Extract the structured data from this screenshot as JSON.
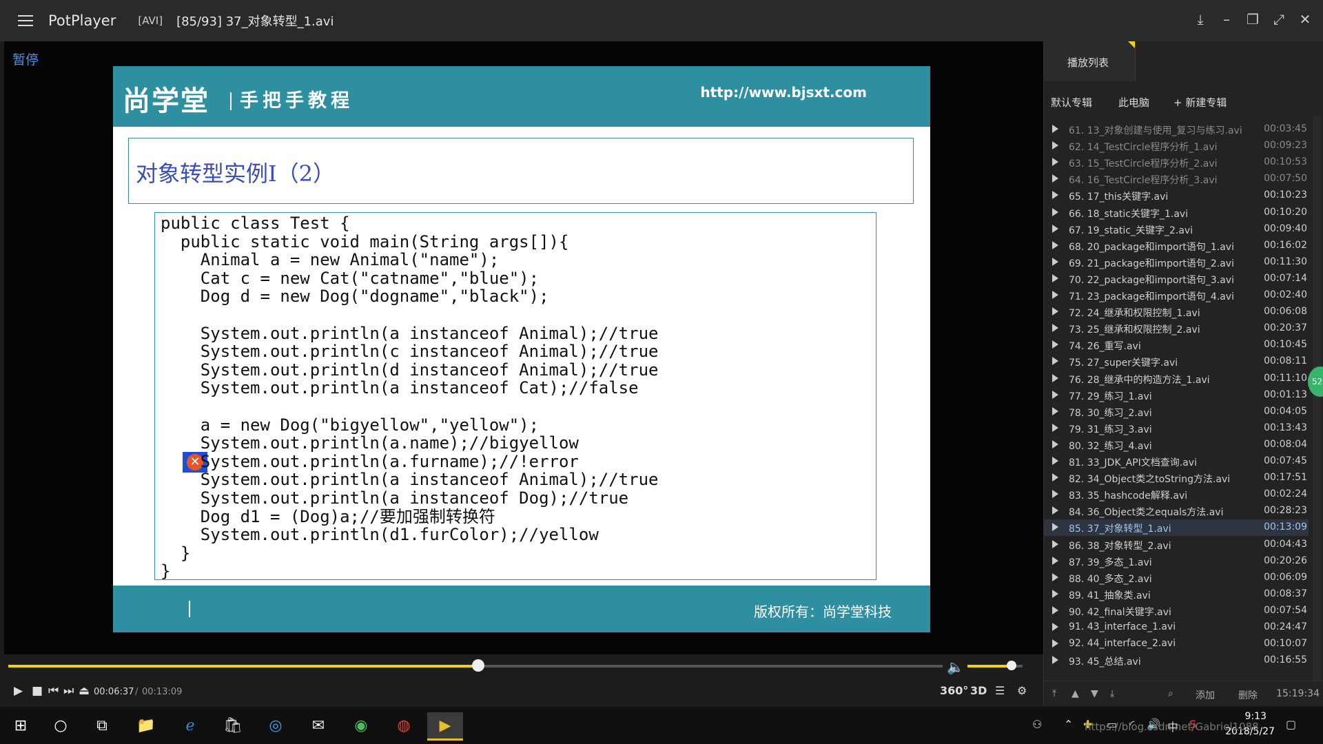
{
  "titlebar": {
    "app_name": "PotPlayer",
    "format": "[AVI]",
    "file_title": "[85/93] 37_对象转型_1.avi"
  },
  "video": {
    "status": "暂停",
    "slide": {
      "logo": "尚学堂",
      "subtitle": "手把手教程",
      "url": "http://www.bjsxt.com",
      "title": "对象转型实例Ⅰ（2）",
      "code": [
        "public class Test {",
        "  public static void main(String args[]){",
        "    Animal a = new Animal(\"name\");",
        "    Cat c = new Cat(\"catname\",\"blue\");",
        "    Dog d = new Dog(\"dogname\",\"black\");",
        "",
        "    System.out.println(a instanceof Animal);//true",
        "    System.out.println(c instanceof Animal);//true",
        "    System.out.println(d instanceof Animal);//true",
        "    System.out.println(a instanceof Cat);//false",
        "",
        "    a = new Dog(\"bigyellow\",\"yellow\");",
        "    System.out.println(a.name);//bigyellow",
        "    System.out.println(a.furname);//!error",
        "    System.out.println(a instanceof Animal);//true",
        "    System.out.println(a instanceof Dog);//true",
        "    Dog d1 = (Dog)a;//要加强制转换符",
        "    System.out.println(d1.furColor);//yellow",
        "  }",
        "}"
      ],
      "footer": "版权所有：尚学堂科技"
    }
  },
  "playback": {
    "current": "00:06:37",
    "separator": "/",
    "total": "00:13:09",
    "progress": 0.503,
    "volume": 0.8
  },
  "controls": {
    "btn_360": "360°",
    "btn_3d": "3D"
  },
  "playlist": {
    "tab": "播放列表",
    "subtabs": [
      "默认专辑",
      "此电脑",
      "+ 新建专辑"
    ],
    "items": [
      {
        "name": "61. 13_对象创建与使用_复习与练习.avi",
        "dur": "00:03:45"
      },
      {
        "name": "62. 14_TestCircle程序分析_1.avi",
        "dur": "00:09:23"
      },
      {
        "name": "63. 15_TestCircle程序分析_2.avi",
        "dur": "00:10:53"
      },
      {
        "name": "64. 16_TestCircle程序分析_3.avi",
        "dur": "00:07:50"
      },
      {
        "name": "65. 17_this关键字.avi",
        "dur": "00:10:23"
      },
      {
        "name": "66. 18_static关键字_1.avi",
        "dur": "00:10:20"
      },
      {
        "name": "67. 19_static_关键字_2.avi",
        "dur": "00:09:40"
      },
      {
        "name": "68. 20_package和import语句_1.avi",
        "dur": "00:16:02"
      },
      {
        "name": "69. 21_package和import语句_2.avi",
        "dur": "00:11:30"
      },
      {
        "name": "70. 22_package和import语句_3.avi",
        "dur": "00:07:14"
      },
      {
        "name": "71. 23_package和import语句_4.avi",
        "dur": "00:02:40"
      },
      {
        "name": "72. 24_继承和权限控制_1.avi",
        "dur": "00:06:08"
      },
      {
        "name": "73. 25_继承和权限控制_2.avi",
        "dur": "00:20:37"
      },
      {
        "name": "74. 26_重写.avi",
        "dur": "00:10:45"
      },
      {
        "name": "75. 27_super关键字.avi",
        "dur": "00:08:11"
      },
      {
        "name": "76. 28_继承中的构造方法_1.avi",
        "dur": "00:11:10"
      },
      {
        "name": "77. 29_练习_1.avi",
        "dur": "00:01:13"
      },
      {
        "name": "78. 30_练习_2.avi",
        "dur": "00:04:05"
      },
      {
        "name": "79. 31_练习_3.avi",
        "dur": "00:13:43"
      },
      {
        "name": "80. 32_练习_4.avi",
        "dur": "00:08:04"
      },
      {
        "name": "81. 33_JDK_API文档查询.avi",
        "dur": "00:07:45"
      },
      {
        "name": "82. 34_Object类之toString方法.avi",
        "dur": "00:17:51"
      },
      {
        "name": "83. 35_hashcode解释.avi",
        "dur": "00:02:24"
      },
      {
        "name": "84. 36_Object类之equals方法.avi",
        "dur": "00:28:23"
      },
      {
        "name": "85. 37_对象转型_1.avi",
        "dur": "00:13:09",
        "active": true
      },
      {
        "name": "86. 38_对象转型_2.avi",
        "dur": "00:04:43"
      },
      {
        "name": "87. 39_多态_1.avi",
        "dur": "00:20:26"
      },
      {
        "name": "88. 40_多态_2.avi",
        "dur": "00:06:09"
      },
      {
        "name": "89. 41_抽象类.avi",
        "dur": "00:08:37"
      },
      {
        "name": "90. 42_final关键字.avi",
        "dur": "00:07:54"
      },
      {
        "name": "91. 43_interface_1.avi",
        "dur": "00:24:47"
      },
      {
        "name": "92. 44_interface_2.avi",
        "dur": "00:10:07"
      },
      {
        "name": "93. 45_总结.avi",
        "dur": "00:16:55"
      }
    ],
    "add": "添加",
    "delete": "删除",
    "clock": "15:19:34"
  },
  "taskbar": {
    "time": "9:13",
    "date": "2018/5/27",
    "ime": "中",
    "watermark": "https://blog.csdn.net/Gabriel1088",
    "edge_badge": "52"
  },
  "colors": {
    "accent": "#f2cf1a",
    "slide_teal": "#2d8fa0",
    "pause_blue": "#4a93e3"
  }
}
